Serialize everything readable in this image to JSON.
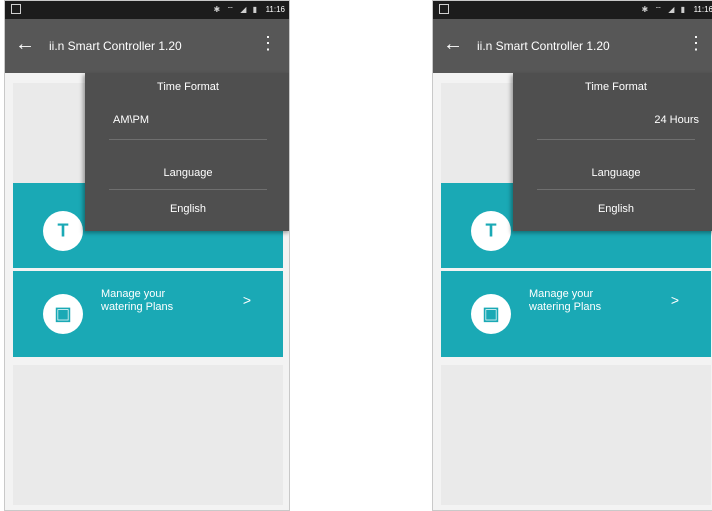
{
  "screens": [
    {
      "status_time": "11:16",
      "status_icons": "✱ ⌔ ◢ ▮",
      "app_title": "ii.n Smart Controller 1.20",
      "menu": {
        "time_format_label": "Time Format",
        "time_format_selected": "AM\\PM",
        "language_label": "Language",
        "language_value": "English"
      },
      "card_plans_text_line1": "Manage your",
      "card_plans_text_line2": "watering Plans",
      "chevron": ">"
    },
    {
      "status_time": "11:16",
      "status_icons": "✱ ⌔ ◢ ▮",
      "app_title": "ii.n Smart Controller 1.20",
      "menu": {
        "time_format_label": "Time Format",
        "time_format_selected": "24 Hours",
        "language_label": "Language",
        "language_value": "English"
      },
      "card_plans_text_line1": "Manage your",
      "card_plans_text_line2": "watering Plans",
      "chevron": ">"
    }
  ],
  "colors": {
    "appbar": "#575757",
    "menu": "#4f4f4f",
    "teal": "#1aa9b5"
  }
}
